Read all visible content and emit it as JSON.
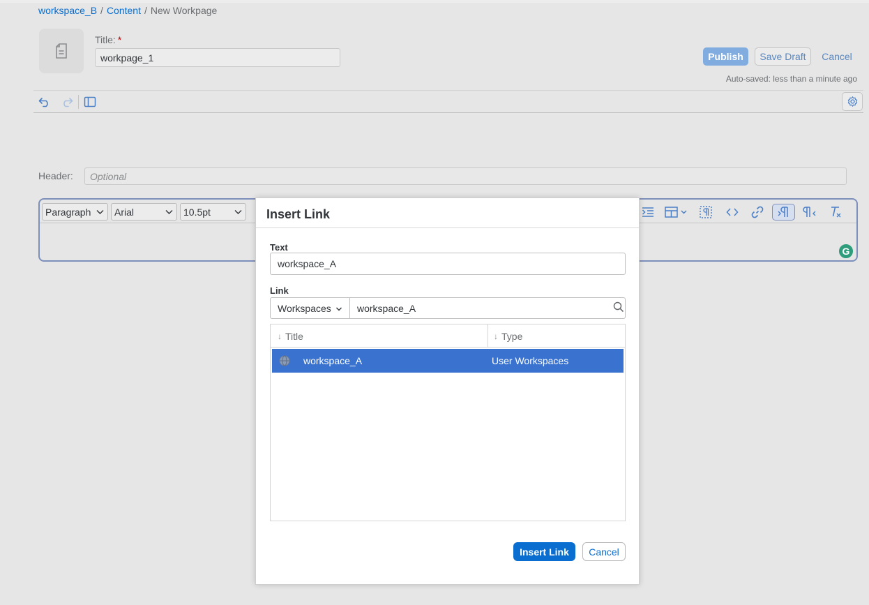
{
  "breadcrumb": {
    "workspace": "workspace_B",
    "content": "Content",
    "separator": "/",
    "current": "New Workpage"
  },
  "page": {
    "title_label": "Title:",
    "required_mark": "*",
    "title_value": "workpage_1"
  },
  "actions": {
    "publish": "Publish",
    "save_draft": "Save Draft",
    "cancel": "Cancel",
    "autosave": "Auto-saved: less than a minute ago"
  },
  "header_field": {
    "label": "Header:",
    "placeholder": "Optional"
  },
  "editor": {
    "paragraph_style": "Paragraph",
    "font": "Arial",
    "font_size": "10.5pt",
    "tool_icons": [
      "indent-icon",
      "table-icon",
      "show-blocks-icon",
      "source-code-icon",
      "link-icon",
      "ltr-icon",
      "rtl-icon",
      "clear-format-icon"
    ]
  },
  "dialog": {
    "title": "Insert Link",
    "text_label": "Text",
    "text_value": "workspace_A",
    "link_label": "Link",
    "link_type": "Workspaces",
    "search_value": "workspace_A",
    "columns": [
      "Title",
      "Type"
    ],
    "sort_arrow": "↓",
    "rows": [
      {
        "title": "workspace_A",
        "type": "User Workspaces",
        "selected": true
      }
    ],
    "insert_button": "Insert Link",
    "cancel_button": "Cancel"
  },
  "colors": {
    "accent": "#0a6ed1",
    "selection": "#3a72d0",
    "required": "#bb0000"
  }
}
